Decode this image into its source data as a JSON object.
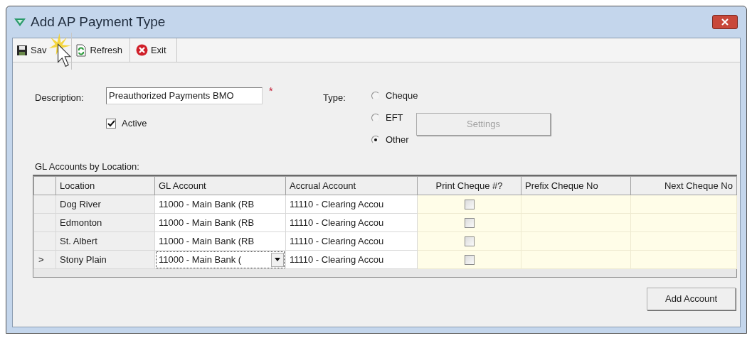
{
  "window": {
    "title": "Add AP Payment Type"
  },
  "toolbar": [
    {
      "kind": "save",
      "label": "Sav"
    },
    {
      "kind": "refresh",
      "label": "Refresh"
    },
    {
      "kind": "exit",
      "label": "Exit"
    }
  ],
  "description": {
    "label": "Description:",
    "value": "Preauthorized Payments BMO",
    "required_mark": "*"
  },
  "active": {
    "label": "Active",
    "checked": true
  },
  "type": {
    "label": "Type:",
    "options": [
      {
        "label": "Cheque",
        "selected": false
      },
      {
        "label": "EFT",
        "selected": false
      },
      {
        "label": "Other",
        "selected": true
      }
    ]
  },
  "settings_button": {
    "label": "Settings",
    "disabled": true
  },
  "grid_label": "GL Accounts by Location:",
  "table": {
    "columns": [
      "Location",
      "GL Account",
      "Accrual Account",
      "Print Cheque #?",
      "Prefix Cheque No",
      "Next Cheque No"
    ],
    "current_marker": ">",
    "rows": [
      {
        "location": "Dog River",
        "gl_account": "11000 - Main Bank (RB",
        "accrual_account": "11110 - Clearing Accou",
        "print_cheque": false,
        "selected": false
      },
      {
        "location": "Edmonton",
        "gl_account": "11000 - Main Bank (RB",
        "accrual_account": "11110 - Clearing Accou",
        "print_cheque": false,
        "selected": false
      },
      {
        "location": "St. Albert",
        "gl_account": "11000 - Main Bank (RB",
        "accrual_account": "11110 - Clearing Accou",
        "print_cheque": false,
        "selected": false
      },
      {
        "location": "Stony Plain",
        "gl_account": "11000 - Main Bank (",
        "accrual_account": "11110 - Clearing Accou",
        "print_cheque": false,
        "selected": true
      }
    ]
  },
  "add_account_button": "Add Account"
}
